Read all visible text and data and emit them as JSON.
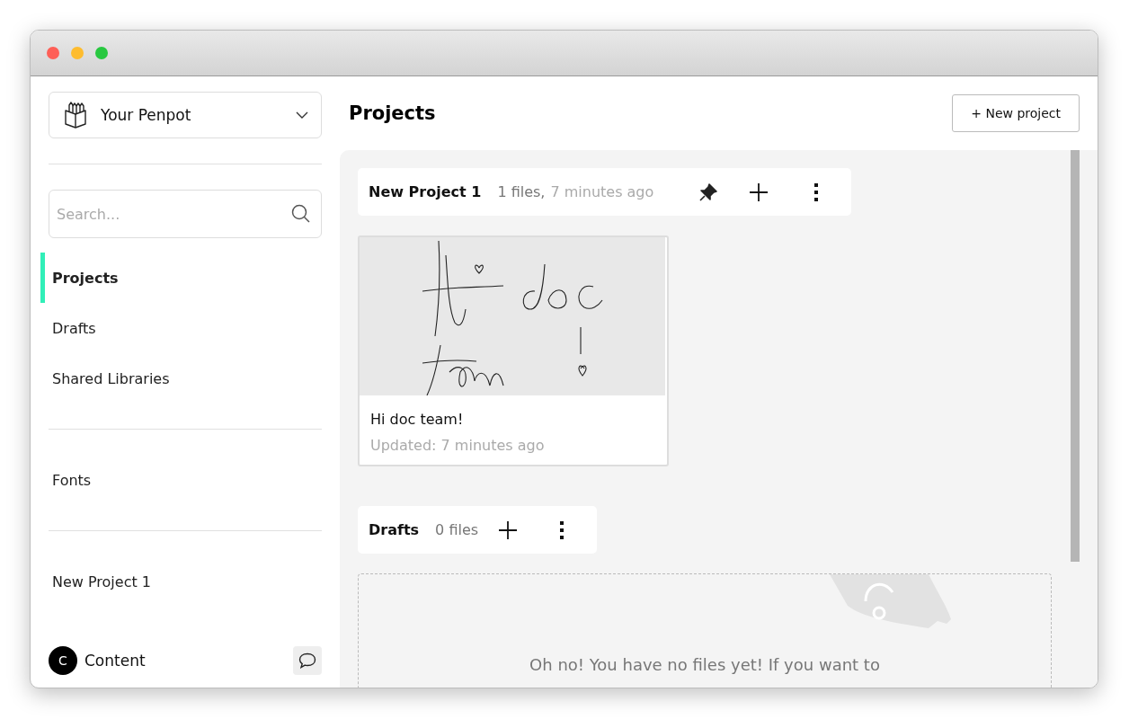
{
  "sidebar": {
    "team": {
      "name": "Your Penpot"
    },
    "search": {
      "placeholder": "Search..."
    },
    "nav": [
      {
        "label": "Projects",
        "selected": true
      },
      {
        "label": "Drafts",
        "selected": false
      },
      {
        "label": "Shared Libraries",
        "selected": false
      }
    ],
    "fonts": {
      "label": "Fonts",
      "selected": false
    },
    "pinned_projects": [
      {
        "label": "New Project 1",
        "selected": false
      }
    ],
    "profile": {
      "initial": "C",
      "name": "Content"
    }
  },
  "header": {
    "title": "Projects",
    "new_project_button": "+ New project"
  },
  "projects": [
    {
      "name": "New Project 1",
      "count": "1 files,",
      "updated": "7 minutes ago",
      "pinned": true,
      "files": [
        {
          "name": "Hi doc team!",
          "updated": "Updated: 7 minutes ago"
        }
      ]
    },
    {
      "name": "Drafts",
      "count": "0 files",
      "pinned": false,
      "empty_message": "Oh no! You have no files yet! If you want to"
    }
  ]
}
